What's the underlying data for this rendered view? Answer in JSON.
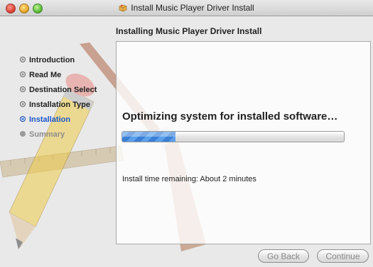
{
  "window": {
    "title": "Install Music Player Driver Install"
  },
  "heading": "Installing Music Player Driver Install",
  "sidebar": {
    "items": [
      {
        "label": "Introduction"
      },
      {
        "label": "Read Me"
      },
      {
        "label": "Destination Select"
      },
      {
        "label": "Installation Type"
      },
      {
        "label": "Installation"
      },
      {
        "label": "Summary"
      }
    ]
  },
  "main": {
    "status": "Optimizing system for installed software…",
    "progress_fraction": 0.24,
    "remaining": "Install time remaining: About 2 minutes"
  },
  "buttons": {
    "back": "Go Back",
    "continue": "Continue"
  },
  "icons": {
    "title": "installer-package-icon"
  },
  "colors": {
    "active_step": "#1a56c8",
    "progress": "#3b7fd6"
  }
}
